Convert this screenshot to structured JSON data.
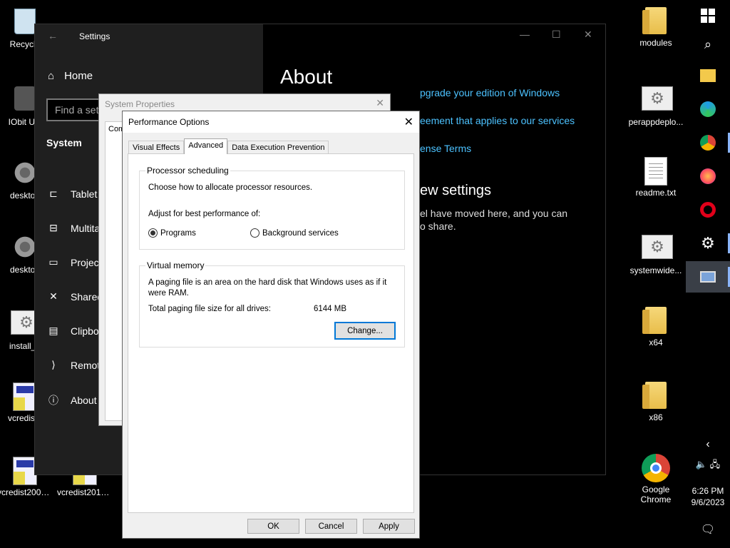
{
  "desktop_left": [
    {
      "label": "Recycle",
      "kind": "recycle"
    },
    {
      "label": "IObit Unl",
      "kind": "iobit"
    },
    {
      "label": "desktop",
      "kind": "grayset"
    },
    {
      "label": "desktop",
      "kind": "grayset"
    },
    {
      "label": "install_a",
      "kind": "gearfile"
    },
    {
      "label": "vcredist2",
      "kind": "setup"
    },
    {
      "label": "vcredist2005...",
      "kind": "setup"
    },
    {
      "label": "vcredist2012...",
      "kind": "setup"
    }
  ],
  "desktop_right": [
    {
      "label": "modules",
      "kind": "folder"
    },
    {
      "label": "perappdeplo...",
      "kind": "gearfile"
    },
    {
      "label": "readme.txt",
      "kind": "txtfile"
    },
    {
      "label": "systemwide...",
      "kind": "gearfile"
    },
    {
      "label": "x64",
      "kind": "folder"
    },
    {
      "label": "x86",
      "kind": "folder"
    },
    {
      "label": "Google Chrome",
      "kind": "chrome"
    }
  ],
  "clock": {
    "time": "6:26 PM",
    "date": "9/6/2023"
  },
  "settings": {
    "title": "Settings",
    "home": "Home",
    "search_placeholder": "Find a set",
    "section": "System",
    "nav": [
      "Tablet",
      "Multita",
      "Project",
      "Shared",
      "Clipbo",
      "Remot",
      "About"
    ],
    "page_title": "About",
    "links": [
      "pgrade your edition of Windows",
      "eement that applies to our services",
      "ense Terms"
    ],
    "related_heading": "ew settings",
    "related_text_1": "el have moved here, and you can",
    "related_text_2": "o share."
  },
  "system_properties": {
    "title": "System Properties",
    "tab_fragment": "Com"
  },
  "performance_options": {
    "title": "Performance Options",
    "tabs": [
      "Visual Effects",
      "Advanced",
      "Data Execution Prevention"
    ],
    "processor_scheduling": {
      "title": "Processor scheduling",
      "desc": "Choose how to allocate processor resources.",
      "adjust": "Adjust for best performance of:",
      "programs": "Programs",
      "background": "Background services"
    },
    "virtual_memory": {
      "title": "Virtual memory",
      "desc_1": "A paging file is an area on the hard disk that Windows uses as if it",
      "desc_2": "were RAM.",
      "total_label": "Total paging file size for all drives:",
      "total_value": "6144 MB",
      "change": "Change..."
    },
    "ok": "OK",
    "cancel": "Cancel",
    "apply": "Apply"
  }
}
